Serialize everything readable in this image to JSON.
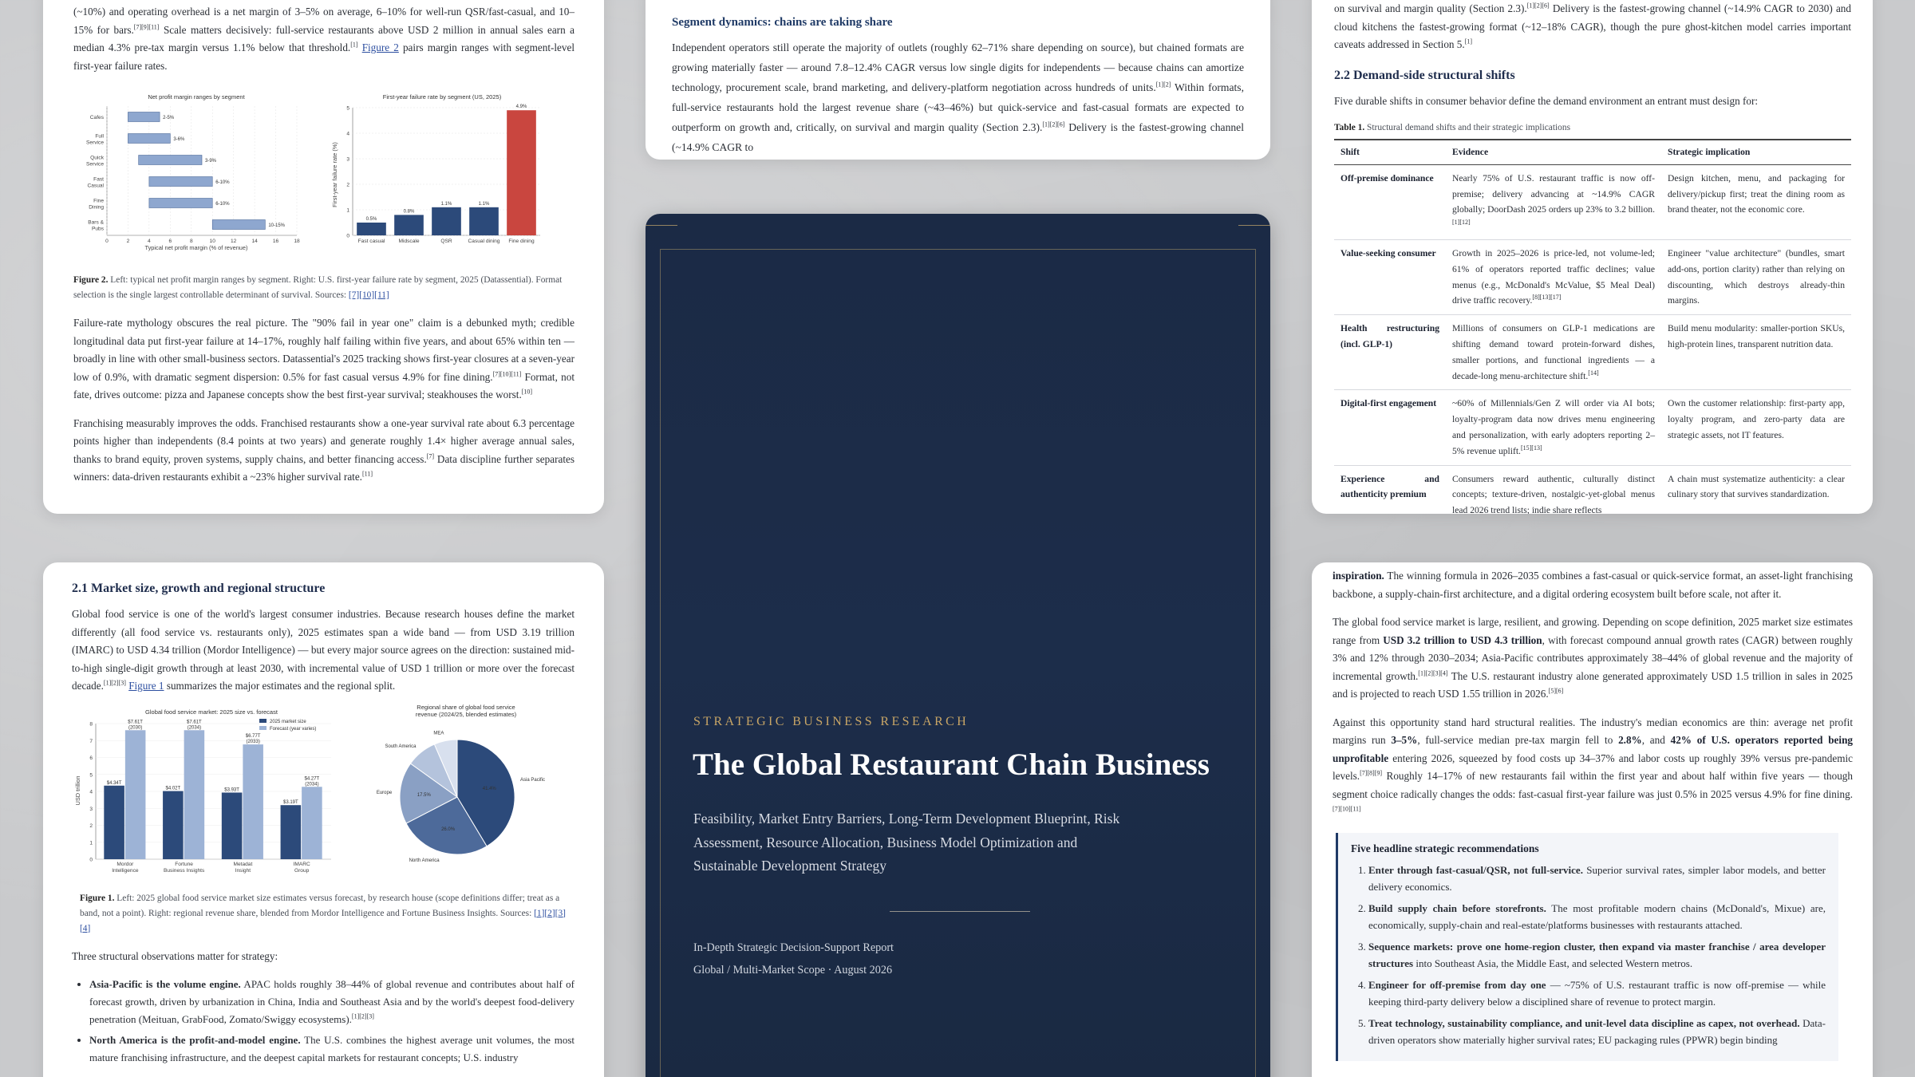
{
  "p1": {
    "para1": {
      "a": "(~10%) and operating overhead is a net margin of 3–5% on average, 6–10% for well-run QSR/fast-casual, and 10–15% for bars.",
      "s1": "[7][9][11]",
      "b": " Scale matters decisively: full-service restaurants above USD 2 million in annual sales earn a median 4.3% pre-tax margin versus 1.1% below that threshold.",
      "s2": "[1]",
      "link": "Figure 2",
      "c": " pairs margin ranges with segment-level first-year failure rates."
    },
    "fig2": {
      "left_title": "Net profit margin ranges by segment",
      "right_title": "First-year failure rate by segment (US, 2025)",
      "xlabel": "Typical net profit margin (% of revenue)",
      "ylabel": "First-year failure rate (%)"
    },
    "caption2": {
      "label": "Figure 2.",
      "text": " Left: typical net profit margin ranges by segment. Right: U.S. first-year failure rate by segment, 2025 (Datassential). Format selection is the single largest controllable determinant of survival. Sources: ",
      "refs": "[7][10][11]"
    },
    "para2": {
      "a": "Failure-rate mythology obscures the real picture. The \"90% fail in year one\" claim is a debunked myth; credible longitudinal data put first-year failure at 14–17%, roughly half failing within five years, and about 65% within ten — broadly in line with other small-business sectors. Datassential's 2025 tracking shows first-year closures at a seven-year low of 0.9%, with dramatic segment dispersion: 0.5% for fast casual versus 4.9% for fine dining.",
      "s1": "[7][10][11]",
      "b": " Format, not fate, drives outcome: pizza and Japanese concepts show the best first-year survival; steakhouses the worst.",
      "s2": "[10]"
    },
    "para3": {
      "a": "Franchising measurably improves the odds. Franchised restaurants show a one-year survival rate about 6.3 percentage points higher than independents (8.4 points at two years) and generate roughly 1.4× higher average annual sales, thanks to brand equity, proven systems, supply chains, and better financing access.",
      "s1": "[7]",
      "b": " Data discipline further separates winners: data-driven restaurants exhibit a ~23% higher survival rate.",
      "s2": "[11]"
    }
  },
  "p2": {
    "heading": "Segment dynamics: chains are taking share",
    "para": {
      "a": "Independent operators still operate the majority of outlets (roughly 62–71% share depending on source), but chained formats are growing materially faster — around 7.8–12.4% CAGR versus low single digits for independents — because chains can amortize technology, procurement scale, brand marketing, and delivery-platform negotiation across hundreds of units.",
      "s1": "[1][2]",
      "b": " Within formats, full-service restaurants hold the largest revenue share (~43–46%) but quick-service and fast-casual formats are expected to outperform on growth and, critically, on survival and margin quality (Section 2.3).",
      "s2": "[1][2][6]",
      "c": " Delivery is the fastest-growing channel (~14.9% CAGR to"
    }
  },
  "p3": {
    "para0": {
      "a": "on survival and margin quality (Section 2.3).",
      "s1": "[1][2][6]",
      "b": " Delivery is the fastest-growing channel (~14.9% CAGR to 2030) and cloud kitchens the fastest-growing format (~12–18% CAGR), though the pure ghost-kitchen model carries important caveats addressed in Section 5.",
      "s2": "[1]"
    },
    "heading": "2.2 Demand-side structural shifts",
    "intro": "Five durable shifts in consumer behavior define the demand environment an entrant must design for:",
    "table_label": "Table 1.",
    "table_caption": " Structural demand shifts and their strategic implications",
    "headers": [
      "Shift",
      "Evidence",
      "Strategic implication"
    ],
    "rows": [
      {
        "shift": "Off-premise dominance",
        "evidence": "Nearly 75% of U.S. restaurant traffic is now off-premise; delivery advancing at ~14.9% CAGR globally; DoorDash 2025 orders up 23% to 3.2 billion.",
        "refs": "[1][12]",
        "impl": "Design kitchen, menu, and packaging for delivery/pickup first; treat the dining room as brand theater, not the economic core."
      },
      {
        "shift": "Value-seeking consumer",
        "evidence": "Growth in 2025–2026 is price-led, not volume-led; 61% of operators reported traffic declines; value menus (e.g., McDonald's McValue, $5 Meal Deal) drive traffic recovery.",
        "refs": "[8][13][17]",
        "impl": "Engineer \"value architecture\" (bundles, smart add-ons, portion clarity) rather than relying on discounting, which destroys already-thin margins."
      },
      {
        "shift": "Health restructuring (incl. GLP-1)",
        "evidence": "Millions of consumers on GLP-1 medications are shifting demand toward protein-forward dishes, smaller portions, and functional ingredients — a decade-long menu-architecture shift.",
        "refs": "[14]",
        "impl": "Build menu modularity: smaller-portion SKUs, high-protein lines, transparent nutrition data."
      },
      {
        "shift": "Digital-first engagement",
        "evidence": "~60% of Millennials/Gen Z will order via AI bots; loyalty-program data now drives menu engineering and personalization, with early adopters reporting 2–5% revenue uplift.",
        "refs": "[15][13]",
        "impl": "Own the customer relationship: first-party app, loyalty program, and zero-party data are strategic assets, not IT features."
      },
      {
        "shift": "Experience and authenticity premium",
        "evidence": "Consumers reward authentic, culturally distinct concepts; texture-driven, nostalgic-yet-global menus lead 2026 trend lists; indie share reflects",
        "refs": "",
        "impl": "A chain must systematize authenticity: a clear culinary story that survives standardization."
      }
    ]
  },
  "p4": {
    "heading": "2.1 Market size, growth and regional structure",
    "para": {
      "a": "Global food service is one of the world's largest consumer industries. Because research houses define the market differently (all food service vs. restaurants only), 2025 estimates span a wide band — from USD 3.19 trillion (IMARC) to USD 4.34 trillion (Mordor Intelligence) — but every major source agrees on the direction: sustained mid-to-high single-digit growth through at least 2030, with incremental value of USD 1 trillion or more over the forecast decade.",
      "s1": "[1][2][3]",
      "link": "Figure 1",
      "b": " summarizes the major estimates and the regional split."
    },
    "fig1": {
      "left_title": "Global food service market: 2025 size vs. forecast",
      "legend": [
        "2025 market size",
        "Forecast (year varies)"
      ],
      "ylabel": "USD trillion",
      "right_title": "Regional share of global food service revenue (2024/25, blended estimates)"
    },
    "caption1": {
      "label": "Figure 1.",
      "text": " Left: 2025 global food service market size estimates versus forecast, by research house (scope definitions differ; treat as a band, not a point). Right: regional revenue share, blended from Mordor Intelligence and Fortune Business Insights. Sources: ",
      "refs": "[1][2][3][4]"
    },
    "obs_intro": "Three structural observations matter for strategy:",
    "bullets": [
      {
        "bold": "Asia-Pacific is the volume engine.",
        "text": " APAC holds roughly 38–44% of global revenue and contributes about half of forecast growth, driven by urbanization in China, India and Southeast Asia and by the world's deepest food-delivery penetration (Meituan, GrabFood, Zomato/Swiggy ecosystems).",
        "refs": "[1][2][3]"
      },
      {
        "bold": "North America is the profit-and-model engine.",
        "text": " The U.S. combines the highest average unit volumes, the most mature franchising infrastructure, and the deepest capital markets for restaurant concepts; U.S. industry",
        "refs": ""
      }
    ]
  },
  "cover": {
    "kicker": "STRATEGIC BUSINESS RESEARCH",
    "title": "The Global Restaurant Chain Business",
    "subtitle": "Feasibility, Market Entry Barriers, Long-Term Development Blueprint, Risk Assessment, Resource Allocation, Business Model Optimization and Sustainable Development Strategy",
    "meta1": "In-Depth Strategic Decision-Support Report",
    "meta2": "Global / Multi-Market Scope · August 2026"
  },
  "p6": {
    "para1": {
      "bold": "inspiration.",
      "text": " The winning formula in 2026–2035 combines a fast-casual or quick-service format, an asset-light franchising backbone, a supply-chain-first architecture, and a digital ordering ecosystem built before scale, not after it."
    },
    "para2": {
      "a": "The global food service market is large, resilient, and growing. Depending on scope definition, 2025 market size estimates range from ",
      "b1": "USD 3.2 trillion to USD 4.3 trillion",
      "b": ", with forecast compound annual growth rates (CAGR) between roughly 3% and 12% through 2030–2034; Asia-Pacific contributes approximately 38–44% of global revenue and the majority of incremental growth.",
      "s1": "[1][2][3][4]",
      "c": " The U.S. restaurant industry alone generated approximately USD 1.5 trillion in sales in 2025 and is projected to reach USD 1.55 trillion in 2026.",
      "s2": "[5][6]"
    },
    "para3": {
      "a": "Against this opportunity stand hard structural realities. The industry's median economics are thin: average net profit margins run ",
      "b1": "3–5%",
      "b": ", full-service median pre-tax margin fell to ",
      "b2": "2.8%",
      "c": ", and ",
      "b3": "42% of U.S. operators reported being unprofitable",
      "d": " entering 2026, squeezed by food costs up 34–37% and labor costs up roughly 39% versus pre-pandemic levels.",
      "s1": "[7][8][9]",
      "e": " Roughly 14–17% of new restaurants fail within the first year and about half within five years — though segment choice radically changes the odds: fast-casual first-year failure was just 0.5% in 2025 versus 4.9% for fine dining.",
      "s2": "[7][10][11]"
    },
    "callout_title": "Five headline strategic recommendations",
    "recs": [
      {
        "bold": "Enter through fast-casual/QSR, not full-service.",
        "text": " Superior survival rates, simpler labor models, and better delivery economics."
      },
      {
        "bold": "Build supply chain before storefronts.",
        "text": " The most profitable modern chains (McDonald's, Mixue) are, economically, supply-chain and real-estate/platforms businesses with restaurants attached."
      },
      {
        "bold": "Sequence markets: prove one home-region cluster, then expand via master franchise / area developer structures",
        "text": " into Southeast Asia, the Middle East, and selected Western metros."
      },
      {
        "bold": "Engineer for off-premise from day one",
        "text": " — ~75% of U.S. restaurant traffic is now off-premise — while keeping third-party delivery below a disciplined share of revenue to protect margin."
      },
      {
        "bold": "Treat technology, sustainability compliance, and unit-level data discipline as capex, not overhead.",
        "text": " Data-driven operators show materially higher survival rates; EU packaging rules (PPWR) begin binding"
      }
    ]
  },
  "chart_data": [
    {
      "type": "bar",
      "title": "Net profit margin ranges by segment",
      "orientation": "horizontal-range",
      "categories": [
        "Cafes",
        "Full Service",
        "Quick Service",
        "Fast Casual",
        "Fine Dining",
        "Bars & Pubs"
      ],
      "ranges": [
        [
          2,
          5
        ],
        [
          2,
          6
        ],
        [
          3,
          9
        ],
        [
          4,
          10
        ],
        [
          4,
          10
        ],
        [
          10,
          15
        ]
      ],
      "labels": [
        "2-5%",
        "3-6%",
        "3-9%",
        "6-10%",
        "6-10%",
        "10-15%"
      ],
      "xlabel": "Typical net profit margin (% of revenue)",
      "xlim": [
        0,
        18
      ],
      "xticks": [
        0,
        2,
        4,
        6,
        8,
        10,
        12,
        14,
        16,
        18
      ]
    },
    {
      "type": "bar",
      "title": "First-year failure rate by segment (US, 2025)",
      "categories": [
        "Fast casual",
        "Midscale",
        "QSR",
        "Casual dining",
        "Fine dining"
      ],
      "values": [
        0.5,
        0.8,
        1.1,
        1.1,
        4.9
      ],
      "labels": [
        "0.5%",
        "0.8%",
        "1.1%",
        "1.1%",
        "4.9%"
      ],
      "ylabel": "First-year failure rate (%)",
      "ylim": [
        0,
        5
      ],
      "yticks": [
        0,
        1,
        2,
        3,
        4,
        5
      ]
    },
    {
      "type": "bar",
      "title": "Global food service market: 2025 size vs. forecast",
      "categories": [
        "Mordor Intelligence",
        "Fortune Business Insights",
        "Metadat Insight",
        "IMARC Group"
      ],
      "series": [
        {
          "name": "2025 market size",
          "values": [
            4.34,
            4.02,
            3.93,
            3.19
          ],
          "labels": [
            "$4.34T",
            "$4.02T",
            "$3.93T",
            "$3.19T"
          ]
        },
        {
          "name": "Forecast (year varies)",
          "values": [
            7.61,
            7.61,
            6.77,
            4.27
          ],
          "labels": [
            "$7.61T (2030)",
            "$7.61T (2034)",
            "$6.77T (2033)",
            "$4.27T (2034)"
          ]
        }
      ],
      "ylabel": "USD trillion",
      "ylim": [
        0,
        8
      ],
      "yticks": [
        0,
        1,
        2,
        3,
        4,
        5,
        6,
        7,
        8
      ]
    },
    {
      "type": "pie",
      "title": "Regional share of global food service revenue (2024/25, blended estimates)",
      "categories": [
        "Asia Pacific",
        "North America",
        "Europe",
        "South America",
        "MEA"
      ],
      "values": [
        41.4,
        26.0,
        17.5,
        8.6,
        6.5
      ],
      "labels": [
        "41.4%",
        "26.0%",
        "17.5%",
        "",
        ""
      ],
      "colors": [
        "#2c4a7a",
        "#4d6a9a",
        "#8aa0c4",
        "#b4c3dc",
        "#d8e0ee"
      ]
    }
  ]
}
